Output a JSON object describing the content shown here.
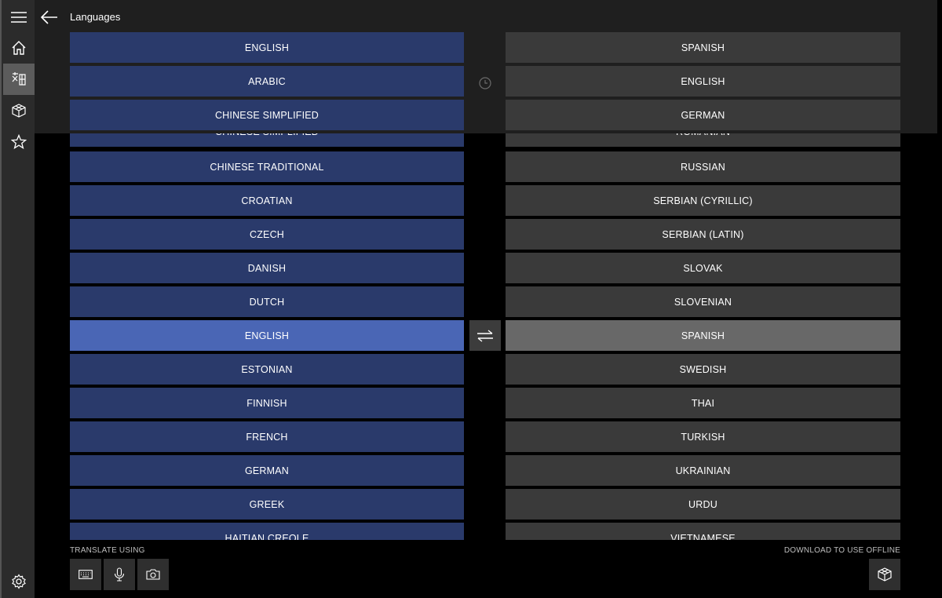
{
  "header": {
    "title": "Languages"
  },
  "nav": {
    "items": [
      {
        "name": "menu-icon"
      },
      {
        "name": "home-icon"
      },
      {
        "name": "translator-icon",
        "active": true
      },
      {
        "name": "offline-languages-icon"
      },
      {
        "name": "favorites-icon"
      },
      {
        "name": "settings-icon"
      }
    ]
  },
  "recent": {
    "source": [
      "ENGLISH",
      "ARABIC",
      "CHINESE SIMPLIFIED"
    ],
    "target": [
      "SPANISH",
      "ENGLISH",
      "GERMAN"
    ]
  },
  "source_list": {
    "partial_top": "CHINESE SIMPLIFIED",
    "items": [
      "CHINESE TRADITIONAL",
      "CROATIAN",
      "CZECH",
      "DANISH",
      "DUTCH",
      "ENGLISH",
      "ESTONIAN",
      "FINNISH",
      "FRENCH",
      "GERMAN",
      "GREEK"
    ],
    "partial_bottom": "HAITIAN CREOLE",
    "selected": "ENGLISH"
  },
  "target_list": {
    "partial_top": "ROMANIAN",
    "items": [
      "RUSSIAN",
      "SERBIAN (CYRILLIC)",
      "SERBIAN (LATIN)",
      "SLOVAK",
      "SLOVENIAN",
      "SPANISH",
      "SWEDISH",
      "THAI",
      "TURKISH",
      "UKRAINIAN",
      "URDU"
    ],
    "partial_bottom": "VIETNAMESE",
    "selected": "SPANISH"
  },
  "footer": {
    "translate_using_label": "TRANSLATE USING",
    "download_label": "DOWNLOAD TO USE OFFLINE",
    "tools": [
      "keyboard-icon",
      "microphone-icon",
      "camera-icon"
    ]
  },
  "colors": {
    "source_bg": "#2a3a6b",
    "source_selected": "#4a66b5",
    "target_bg": "#3a3a3a",
    "target_selected": "#686868"
  }
}
